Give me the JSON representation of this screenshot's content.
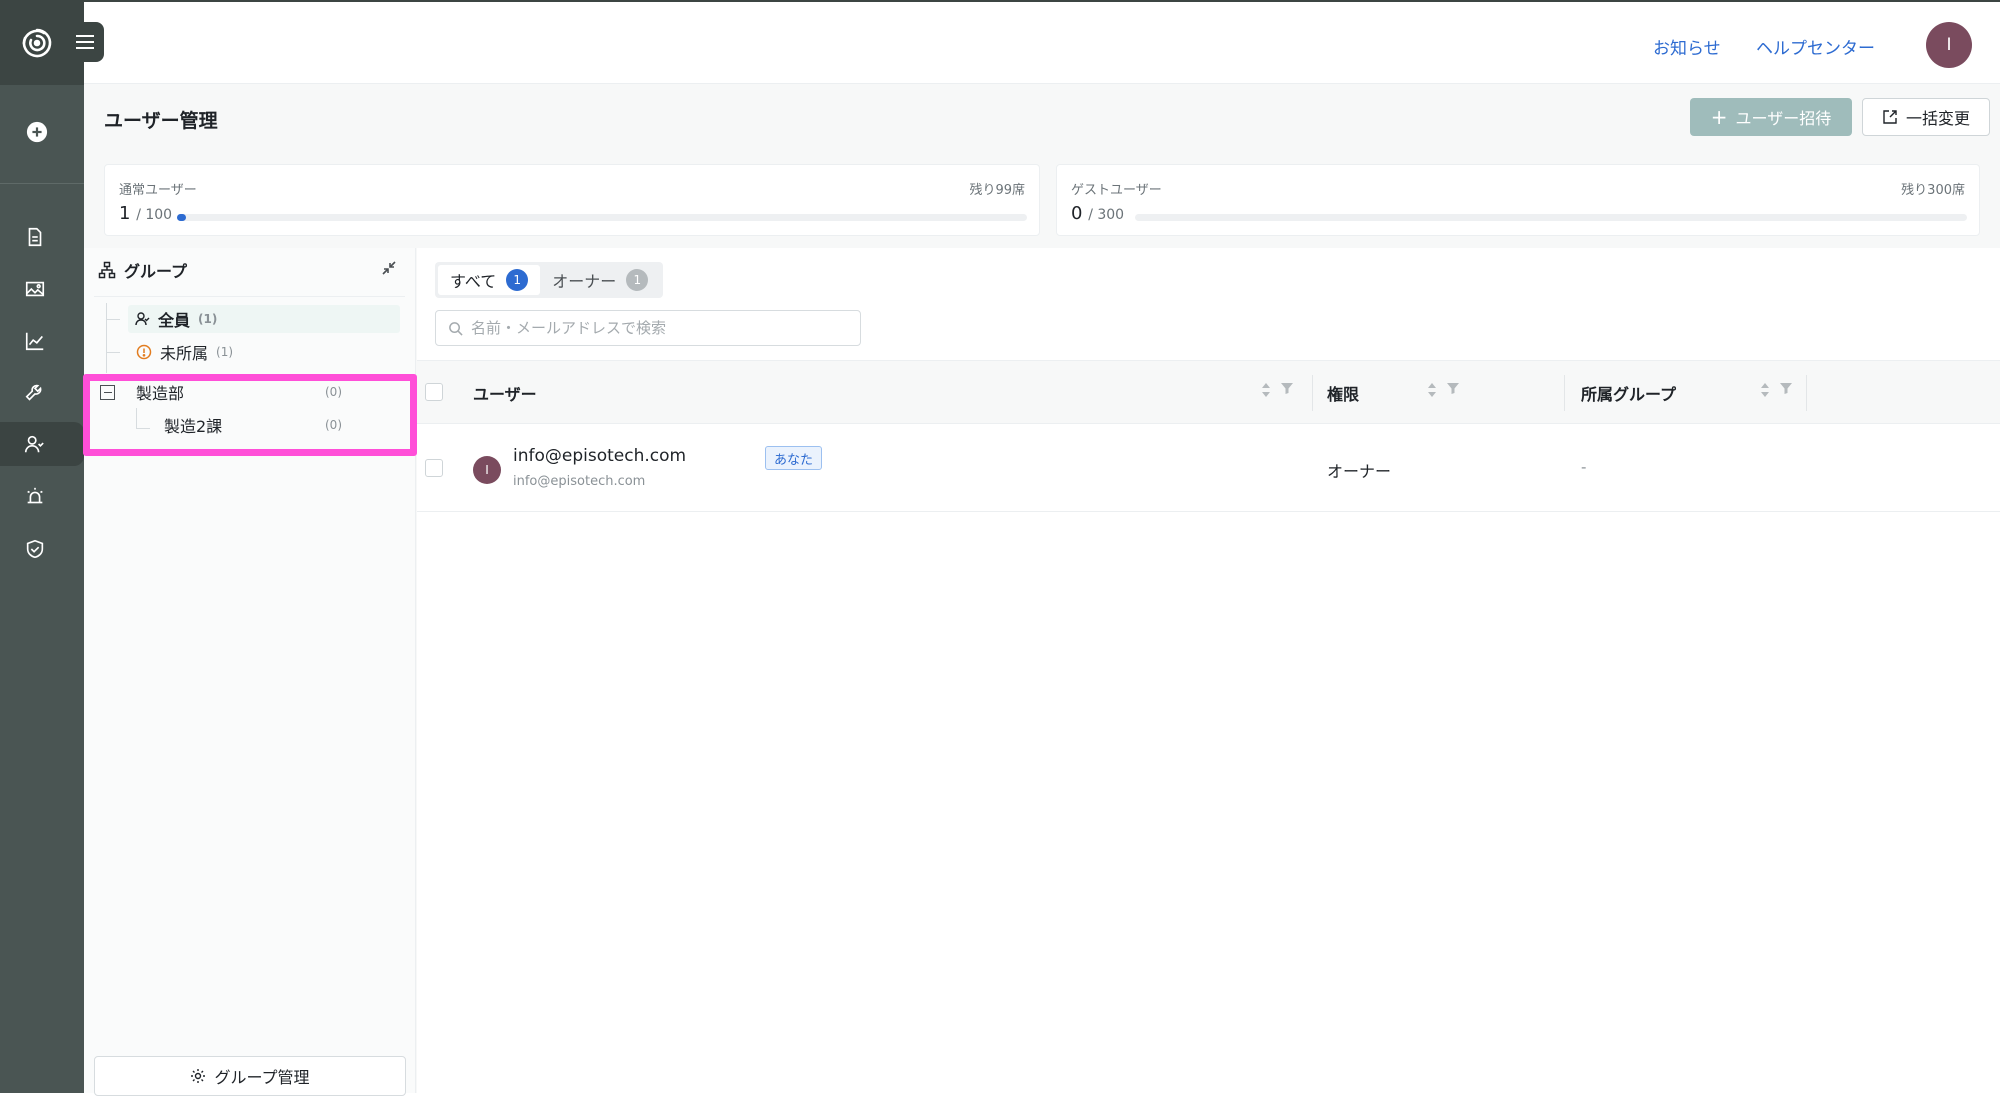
{
  "header": {
    "notice_link": "お知らせ",
    "help_link": "ヘルプセンター",
    "avatar_initial": "I"
  },
  "sidebar": {
    "items": [
      {
        "name": "logo-icon"
      },
      {
        "name": "add-icon"
      },
      {
        "name": "document-icon"
      },
      {
        "name": "image-icon"
      },
      {
        "name": "chart-icon"
      },
      {
        "name": "wrench-icon"
      },
      {
        "name": "users-icon",
        "active": true
      },
      {
        "name": "alarm-icon"
      },
      {
        "name": "shield-check-icon"
      }
    ]
  },
  "page": {
    "title": "ユーザー管理",
    "invite_button": "ユーザー招待",
    "bulk_button": "一括変更"
  },
  "quota": {
    "regular": {
      "label": "通常ユーザー",
      "count": "1",
      "limit": "/ 100",
      "remaining": "残り99席",
      "fill": 0.01
    },
    "guest": {
      "label": "ゲストユーザー",
      "count": "0",
      "limit": "/ 300",
      "remaining": "残り300席",
      "fill": 0.0
    }
  },
  "groups": {
    "title": "グループ",
    "items": [
      {
        "label": "全員",
        "count": "(1)"
      },
      {
        "label": "未所属",
        "count": "(1)"
      },
      {
        "label": "製造部",
        "count": "(0)"
      },
      {
        "label": "製造2課",
        "count": "(0)"
      }
    ],
    "manage_button": "グループ管理"
  },
  "list": {
    "tabs": [
      {
        "label": "すべて",
        "count": "1",
        "color": "#2d6bd1"
      },
      {
        "label": "オーナー",
        "count": "1",
        "color": "#b5babd"
      }
    ],
    "search_placeholder": "名前・メールアドレスで検索",
    "columns": [
      "ユーザー",
      "権限",
      "所属グループ"
    ],
    "rows": [
      {
        "avatar": "I",
        "email": "info@episotech.com",
        "sub_email": "info@episotech.com",
        "badge": "あなた",
        "role": "オーナー",
        "group": "-"
      }
    ]
  },
  "colors": {
    "sidebar": "#4a5553",
    "accent": "#2d6bd1",
    "highlight": "#ff4fd8",
    "avatar": "#7a4b5e"
  }
}
